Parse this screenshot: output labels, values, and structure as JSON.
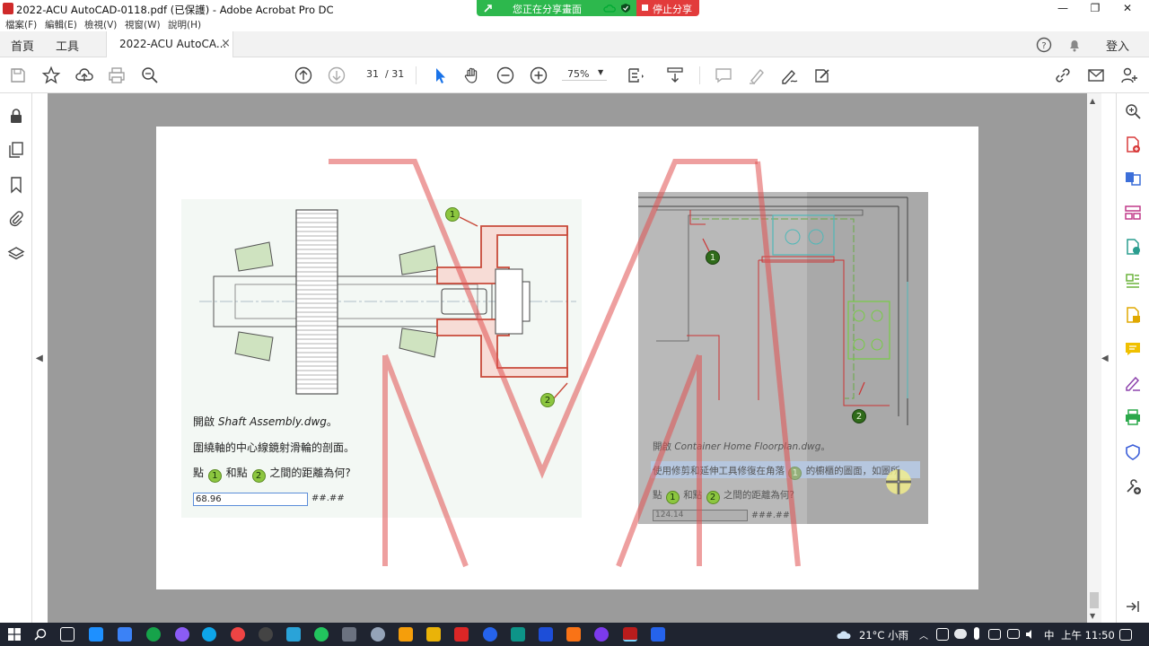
{
  "window": {
    "title": "2022-ACU AutoCAD-0118.pdf (已保護) - Adobe Acrobat Pro DC",
    "minimize": "—",
    "restore": "❐",
    "close": "✕"
  },
  "share_banner": {
    "status": "您正在分享畫面",
    "stop_label": "停止分享"
  },
  "menu": [
    "檔案(F)",
    "編輯(E)",
    "檢視(V)",
    "視窗(W)",
    "說明(H)"
  ],
  "tabs": {
    "home": "首頁",
    "tools": "工具",
    "document": "2022-ACU AutoCA...",
    "close": "×",
    "signin": "登入"
  },
  "toolbar": {
    "page_current": "31",
    "page_total": "/ 31",
    "zoom": "75%"
  },
  "page_left": {
    "line1_prefix": "開啟 ",
    "line1_file": "Shaft Assembly.dwg",
    "line1_suffix": "。",
    "line2": "圍繞軸的中心線鏡射滑輪的剖面。",
    "line3_a": "點",
    "line3_b": "和點",
    "line3_c": "之間的距離為何?",
    "marker1": "1",
    "marker2": "2",
    "answer_value": "68.96",
    "answer_format": "##.##"
  },
  "page_right": {
    "line1_prefix": "開啟 ",
    "line1_file": "Container Home Floorplan.dwg",
    "line1_suffix": "。",
    "line2_a": "使用修剪和延伸工具修復在角落",
    "line2_b": "的櫥櫃的圖面，如圖所",
    "line3_a": "點",
    "line3_b": "和點",
    "line3_c": "之間的距離為何?",
    "marker1": "1",
    "marker2": "2",
    "answer_value": "124.14",
    "answer_format": "###.##"
  },
  "taskbar": {
    "weather": "21°C 小雨",
    "ime": "中",
    "clock": "上午 11:50"
  },
  "colors": {
    "share_green": "#2db84d",
    "share_red": "#e23b3b",
    "acrobat_red": "#cf2a2a",
    "taskbar": "#1f2430",
    "watermark": "#e05050"
  }
}
